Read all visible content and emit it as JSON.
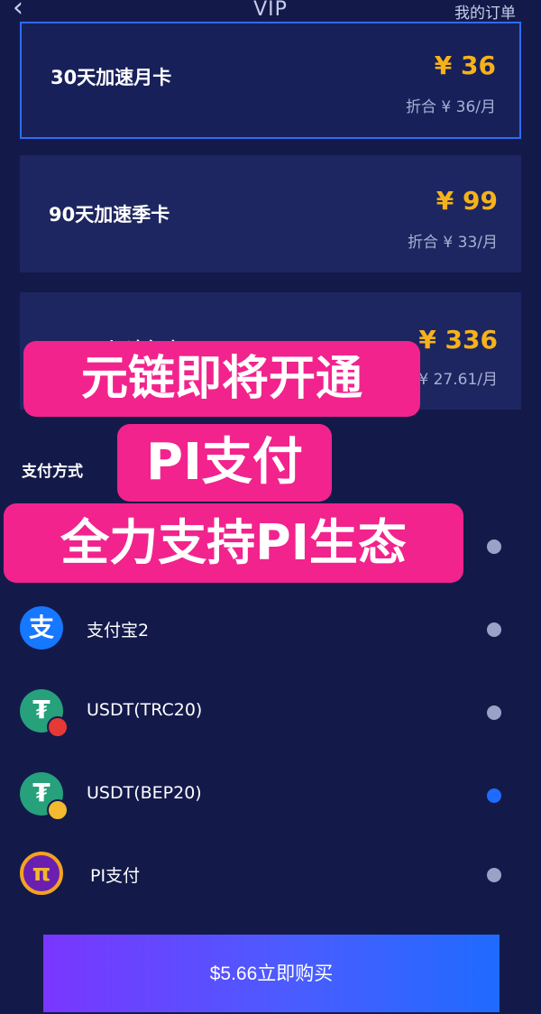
{
  "header": {
    "back_icon": "chevron-left-icon",
    "title": "VIP",
    "orders_label": "我的订单"
  },
  "plans": [
    {
      "name": "30天加速月卡",
      "price": "¥ 36",
      "per_month": "折合 ¥ 36/月",
      "selected": true
    },
    {
      "name": "90天加速季卡",
      "price": "¥ 99",
      "per_month": "折合 ¥ 33/月",
      "selected": false
    },
    {
      "name": "365天加速年卡",
      "price": "¥ 336",
      "per_month": "折合 ¥ 27.61/月",
      "selected": false
    }
  ],
  "payment": {
    "section_title": "支付方式",
    "methods": [
      {
        "label": "支付宝2",
        "icon": "alipay-icon",
        "selected": false
      },
      {
        "label": "USDT(TRC20)",
        "icon": "tether-trc20-icon",
        "selected": false
      },
      {
        "label": "USDT(BEP20)",
        "icon": "tether-bep20-icon",
        "selected": true
      },
      {
        "label": "PI支付",
        "icon": "pi-network-icon",
        "selected": false
      }
    ]
  },
  "buy_button": {
    "label": "$5.66立即购买"
  },
  "promo": {
    "line1": "元链即将开通",
    "line2": "PI支付",
    "line3": "全力支持PI生态",
    "color": "#f2238d"
  },
  "colors": {
    "background": "#131a4a",
    "card": "#1d2660",
    "price": "#f6b21a",
    "accent": "#1f6bff"
  }
}
